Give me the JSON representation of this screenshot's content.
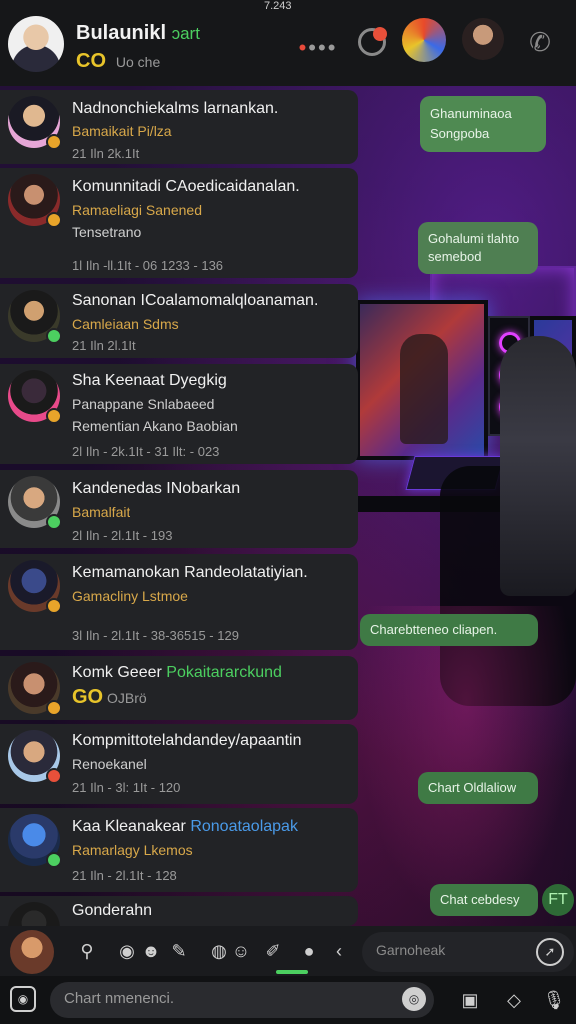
{
  "status": {
    "time": "7.243"
  },
  "header": {
    "title": "Bulaunikl",
    "title_accent": "ɔart",
    "sub_go": "CO",
    "subtitle": "Uo che",
    "dots": "•••"
  },
  "chats": [
    {
      "name": "Nadnonchiekalms larnankan.",
      "preview": "Bamaikait Pi/lza",
      "meta": "21 Iln 2k.1It",
      "badge_color": "#e8a42a"
    },
    {
      "name": "Komunnitadi CAoedicaidanalan.",
      "preview": "Ramaeliagi Sanened",
      "preview2": "Tensetrano",
      "meta": "1l Iln -ll.1It - 06 1233 - 136",
      "badge_color": "#e8a42a"
    },
    {
      "name": "Sanonan ICoalamomalqloanaman.",
      "preview": "Camleiaan Sdms",
      "meta": "21 Iln 2l.1It",
      "badge_color": "#4ccf60"
    },
    {
      "name": "Sha Keenaat Dyegkig",
      "preview": "Panappane Snlabaeed",
      "preview2": "Rementian Akano Baobian",
      "meta": "2l Iln - 2k.1It - 31 Ilt: - 023",
      "badge_color": "#e8a42a"
    },
    {
      "name": "Kandenedas INobarkan",
      "preview": "Bamalfait",
      "meta": "2l Iln - 2l.1It - 193",
      "badge_color": "#4ccf60"
    },
    {
      "name": "Kemamanokan Randeolatatiyian.",
      "preview": "Gamacliny Lstmoe",
      "meta": "3l Iln - 2l.1It - 38-36515 - 129",
      "badge_color": "#e8a42a"
    },
    {
      "name": "Komk Geeer",
      "name_accent": "Pokaitararckund",
      "preview_go": "GO",
      "preview": "OJBrö",
      "badge_color": "#e8a42a"
    },
    {
      "name": "Kompmittotelahdandey/apaantin",
      "preview2": "Renoekanel",
      "meta": "21 Iln - 3l: 1It - 120",
      "badge_color": "#e8503a"
    },
    {
      "name": "Kaa Kleanakear",
      "name_accent": "Ronoataolapak",
      "preview": "Ramarlagy Lkemos",
      "meta": "21 Iln - 2l.1It - 128",
      "badge_color": "#4ccf60"
    },
    {
      "name": "Gonderahn",
      "badge_color": "#e8a42a"
    }
  ],
  "bubbles": {
    "b1_line1": "Ghanuminaoa",
    "b1_line2": "Songpoba",
    "b2_line1": "Gohalumi tlahto",
    "b2_line2": "semebod",
    "b3": "Charebtteneo cliapen.",
    "b4": "Chart Oldlaliow",
    "b5": "Chat cebdesy",
    "b_icon": "FT"
  },
  "toolbar": {
    "search_placeholder": "Garnoheak"
  },
  "composer": {
    "placeholder": "Chart nmenenci."
  }
}
